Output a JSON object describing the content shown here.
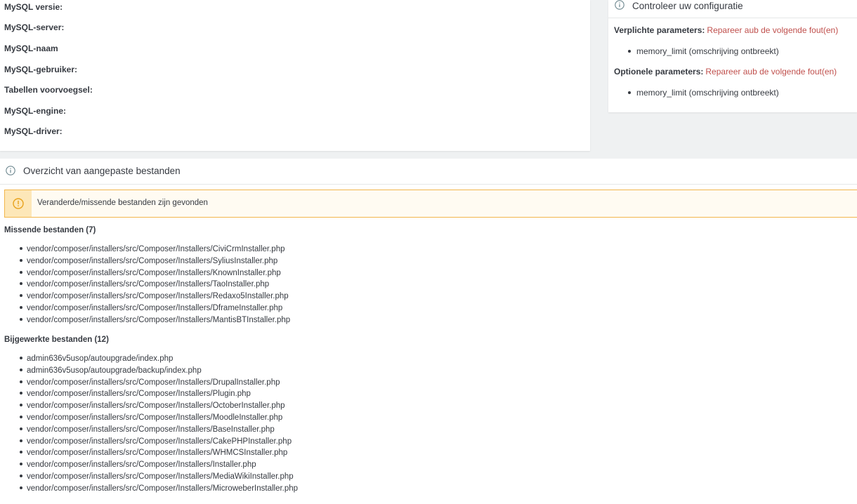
{
  "mysql": {
    "rows": [
      {
        "label": "MySQL versie:",
        "value": ""
      },
      {
        "label": "MySQL-server:",
        "value": ""
      },
      {
        "label": "MySQL-naam",
        "value": ""
      },
      {
        "label": "MySQL-gebruiker:",
        "value": ""
      },
      {
        "label": "Tabellen voorvoegsel:",
        "value": ""
      },
      {
        "label": "MySQL-engine:",
        "value": ""
      },
      {
        "label": "MySQL-driver:",
        "value": ""
      }
    ]
  },
  "config": {
    "title": "Controleer uw configuratie",
    "required": {
      "label": "Verplichte parameters:",
      "message": "Repareer aub de volgende fout(en)",
      "items": [
        "memory_limit (omschrijving ontbreekt)"
      ]
    },
    "optional": {
      "label": "Optionele parameters:",
      "message": "Repareer aub de volgende fout(en)",
      "items": [
        "memory_limit (omschrijving ontbreekt)"
      ]
    }
  },
  "files": {
    "title": "Overzicht van aangepaste bestanden",
    "warning": "Veranderde/missende bestanden zijn gevonden",
    "missing": {
      "heading": "Missende bestanden (7)",
      "items": [
        "vendor/composer/installers/src/Composer/Installers/CiviCrmInstaller.php",
        "vendor/composer/installers/src/Composer/Installers/SyliusInstaller.php",
        "vendor/composer/installers/src/Composer/Installers/KnownInstaller.php",
        "vendor/composer/installers/src/Composer/Installers/TaoInstaller.php",
        "vendor/composer/installers/src/Composer/Installers/Redaxo5Installer.php",
        "vendor/composer/installers/src/Composer/Installers/DframeInstaller.php",
        "vendor/composer/installers/src/Composer/Installers/MantisBTInstaller.php"
      ]
    },
    "updated": {
      "heading": "Bijgewerkte bestanden (12)",
      "items": [
        "admin636v5usop/autoupgrade/index.php",
        "admin636v5usop/autoupgrade/backup/index.php",
        "vendor/composer/installers/src/Composer/Installers/DrupalInstaller.php",
        "vendor/composer/installers/src/Composer/Installers/Plugin.php",
        "vendor/composer/installers/src/Composer/Installers/OctoberInstaller.php",
        "vendor/composer/installers/src/Composer/Installers/MoodleInstaller.php",
        "vendor/composer/installers/src/Composer/Installers/BaseInstaller.php",
        "vendor/composer/installers/src/Composer/Installers/CakePHPInstaller.php",
        "vendor/composer/installers/src/Composer/Installers/WHMCSInstaller.php",
        "vendor/composer/installers/src/Composer/Installers/Installer.php",
        "vendor/composer/installers/src/Composer/Installers/MediaWikiInstaller.php",
        "vendor/composer/installers/src/Composer/Installers/MicroweberInstaller.php"
      ]
    }
  },
  "colors": {
    "error": "#c0504d",
    "warning_border": "#f2b64c",
    "warning_icon_bg": "#fde7b8",
    "warning_icon": "#e8a21c"
  },
  "icons": {
    "info": "info-circle-icon",
    "warning": "exclamation-circle-icon"
  }
}
